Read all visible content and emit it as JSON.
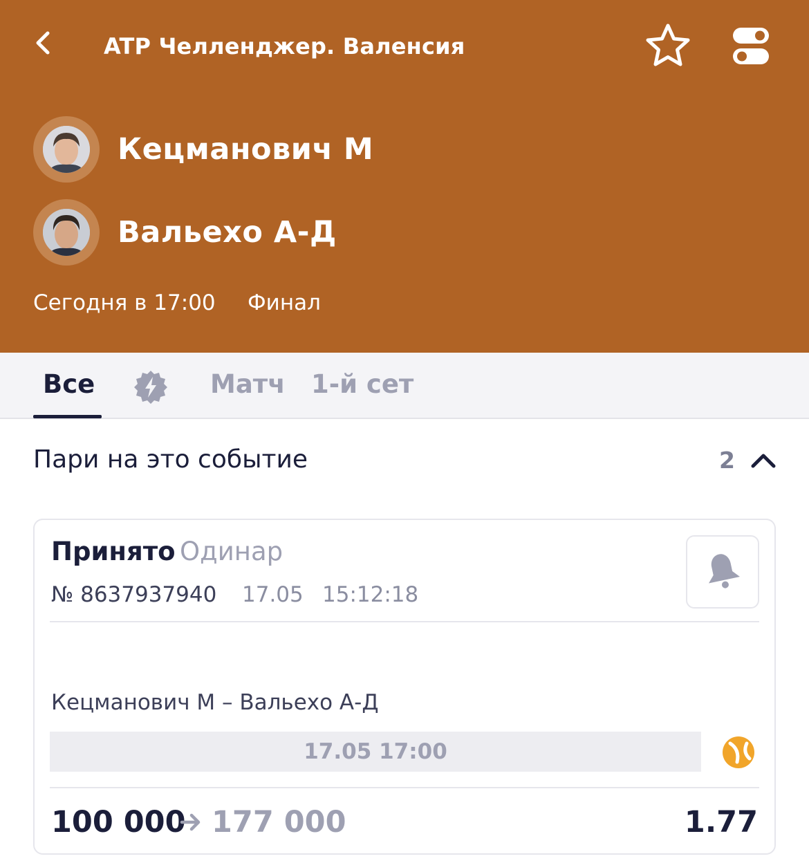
{
  "header": {
    "title": "ATP Челленджер. Валенсия",
    "background": "#b06325"
  },
  "players": [
    {
      "name": "Кецманович М"
    },
    {
      "name": "Вальехо А-Д"
    }
  ],
  "match": {
    "time": "Сегодня в 17:00",
    "stage": "Финал"
  },
  "tabs": {
    "all": "Все",
    "match": "Матч",
    "set1": "1-й сет",
    "active": "all"
  },
  "section": {
    "title": "Пари на это событие",
    "count": "2"
  },
  "bet": {
    "status": "Принято",
    "type": "Одинар",
    "number": "№ 8637937940",
    "date": "17.05",
    "time": "15:12:18",
    "event": "Кецманович М – Вальехо А-Д",
    "event_datetime": "17.05 17:00",
    "stake": "100 000",
    "payout": "177 000",
    "odds": "1.77"
  },
  "icons": {
    "back": "chevron-left-icon",
    "favorite": "star-icon",
    "settings": "toggle-icon",
    "live": "lightning-badge-icon",
    "collapse": "chevron-up-icon",
    "notify": "bell-icon",
    "sport": "tennis-ball-icon",
    "arrow": "arrow-right-icon"
  }
}
